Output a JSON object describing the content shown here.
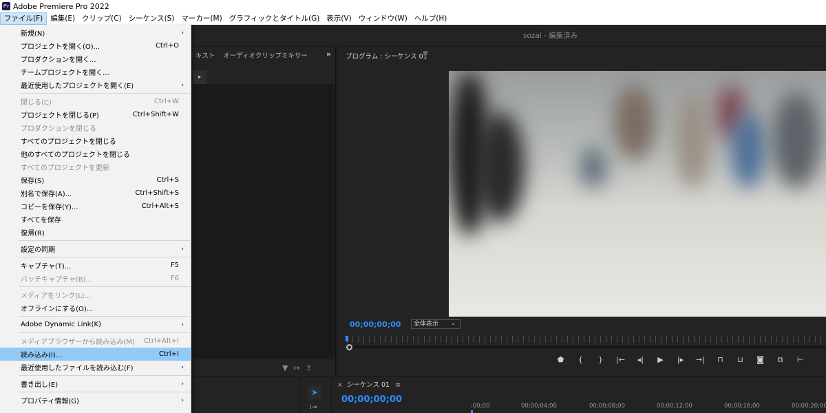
{
  "window": {
    "title": "Adobe Premiere Pro 2022",
    "icon_text": "Pr"
  },
  "menubar": [
    {
      "label": "ファイル(F)",
      "active": true
    },
    {
      "label": "編集(E)"
    },
    {
      "label": "クリップ(C)"
    },
    {
      "label": "シーケンス(S)"
    },
    {
      "label": "マーカー(M)"
    },
    {
      "label": "グラフィックとタイトル(G)"
    },
    {
      "label": "表示(V)"
    },
    {
      "label": "ウィンドウ(W)"
    },
    {
      "label": "ヘルプ(H)"
    }
  ],
  "project_title": "sozai - 編集済み",
  "left_tabs": [
    "キスト",
    "オーディオクリップミキサー"
  ],
  "program": {
    "tab_label": "プログラム : シーケンス 01",
    "timecode": "00;00;00;00",
    "fit_label": "全体表示"
  },
  "sequence": {
    "tab_label": "シーケンス 01",
    "timecode": "00;00;00;00",
    "ruler_labels": [
      ":00;00",
      "00;00;04;00",
      "00;00;08;00",
      "00;00;12;00",
      "00;00;16;00",
      "00;00;20;00"
    ]
  },
  "file_menu": [
    {
      "label": "新規(N)",
      "arrow": true,
      "top": 0
    },
    {
      "label": "プロジェクトを開く(O)...",
      "shortcut": "Ctrl+O"
    },
    {
      "label": "プロダクションを開く..."
    },
    {
      "label": "チームプロジェクトを開く..."
    },
    {
      "label": "最近使用したプロジェクトを開く(E)",
      "arrow": true
    },
    {
      "sep": true
    },
    {
      "label": "閉じる(C)",
      "shortcut": "Ctrl+W",
      "disabled": true
    },
    {
      "label": "プロジェクトを閉じる(P)",
      "shortcut": "Ctrl+Shift+W"
    },
    {
      "label": "プロダクションを閉じる",
      "disabled": true
    },
    {
      "label": "すべてのプロジェクトを閉じる"
    },
    {
      "label": "他のすべてのプロジェクトを閉じる"
    },
    {
      "label": "すべてのプロジェクトを更新",
      "disabled": true
    },
    {
      "label": "保存(S)",
      "shortcut": "Ctrl+S"
    },
    {
      "label": "別名で保存(A)...",
      "shortcut": "Ctrl+Shift+S"
    },
    {
      "label": "コピーを保存(Y)...",
      "shortcut": "Ctrl+Alt+S"
    },
    {
      "label": "すべてを保存"
    },
    {
      "label": "復帰(R)"
    },
    {
      "sep": true
    },
    {
      "label": "設定の同期",
      "arrow": true
    },
    {
      "sep": true
    },
    {
      "label": "キャプチャ(T)...",
      "shortcut": "F5"
    },
    {
      "label": "バッチキャプチャ(B)...",
      "shortcut": "F6",
      "disabled": true
    },
    {
      "sep": true
    },
    {
      "label": "メディアをリンク(L)...",
      "disabled": true
    },
    {
      "label": "オフラインにする(O)..."
    },
    {
      "sep": true
    },
    {
      "label": "Adobe Dynamic Link(K)",
      "arrow": true
    },
    {
      "sep": true
    },
    {
      "label": "メディアブラウザーから読み込み(M)",
      "shortcut": "Ctrl+Alt+I",
      "disabled": true
    },
    {
      "label": "読み込み(I)...",
      "shortcut": "Ctrl+I",
      "highlighted": true
    },
    {
      "label": "最近使用したファイルを読み込む(F)",
      "arrow": true
    },
    {
      "sep": true
    },
    {
      "label": "書き出し(E)",
      "arrow": true
    },
    {
      "sep": true
    },
    {
      "label": "プロパティ情報(G)",
      "arrow": true
    }
  ]
}
